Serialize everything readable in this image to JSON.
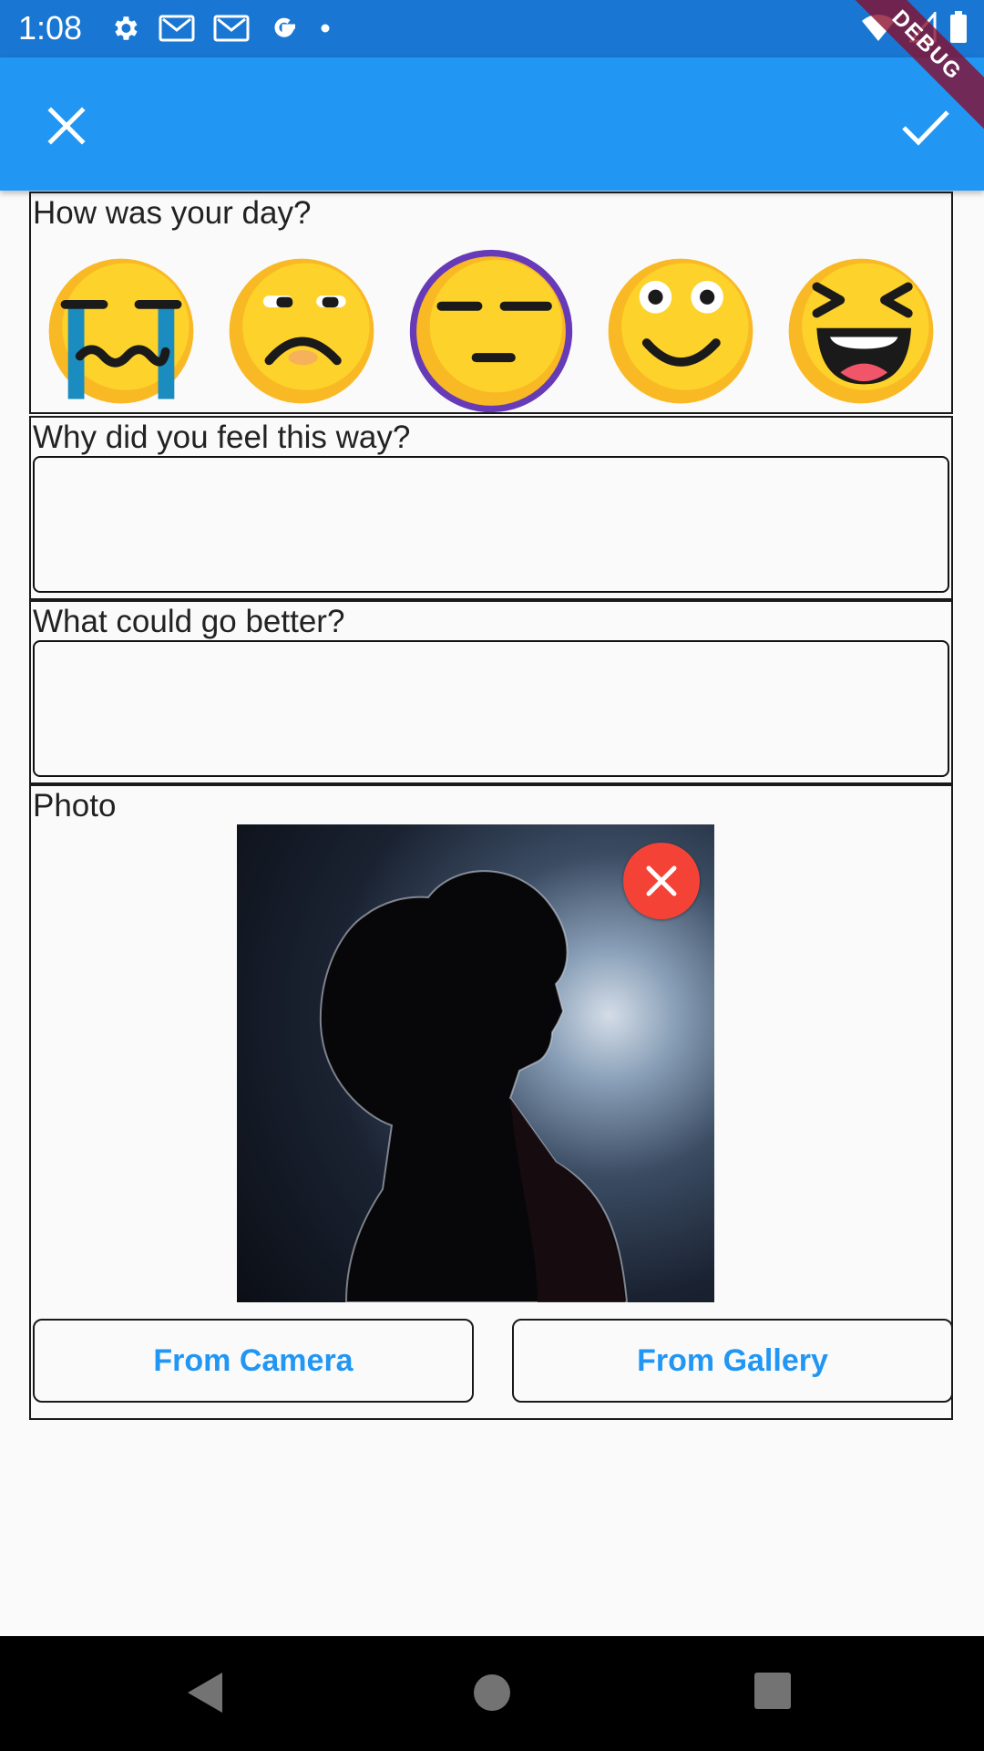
{
  "status_bar": {
    "time": "1:08",
    "icons": [
      "settings-icon",
      "gmail-icon",
      "gmail-icon",
      "google-icon",
      "dot-icon",
      "wifi-icon",
      "signal-icon",
      "battery-icon"
    ],
    "debug_label": "DEBUG"
  },
  "app_bar": {
    "close_icon": "close-icon",
    "confirm_icon": "check-icon",
    "background": "#2196f3"
  },
  "mood_section": {
    "label": "How was your day?",
    "moods": [
      {
        "name": "crying",
        "selected": false
      },
      {
        "name": "sad",
        "selected": false
      },
      {
        "name": "neutral",
        "selected": true
      },
      {
        "name": "happy",
        "selected": false
      },
      {
        "name": "laughing",
        "selected": false
      }
    ],
    "selected_ring_color": "#673ab7"
  },
  "why_section": {
    "label": "Why did you feel this way?",
    "value": ""
  },
  "better_section": {
    "label": "What could go better?",
    "value": ""
  },
  "photo_section": {
    "label": "Photo",
    "remove_icon": "close-icon",
    "camera_button": "From Camera",
    "gallery_button": "From Gallery"
  },
  "nav_bar": {
    "icons": [
      "back-icon",
      "home-icon",
      "recents-icon"
    ]
  }
}
